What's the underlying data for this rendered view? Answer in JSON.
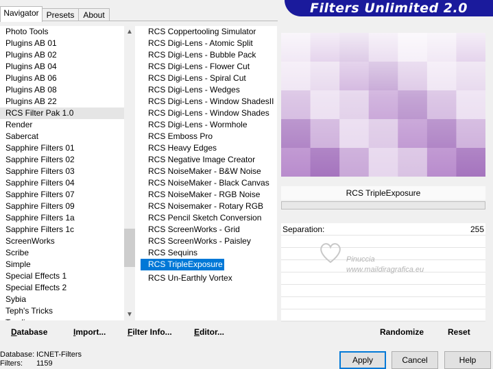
{
  "tabs": [
    "Navigator",
    "Presets",
    "About"
  ],
  "brand": "Filters Unlimited 2.0",
  "categories": [
    "Photo Tools",
    "Plugins AB 01",
    "Plugins AB 02",
    "Plugins AB 04",
    "Plugins AB 06",
    "Plugins AB 08",
    "Plugins AB 22",
    "RCS Filter Pak 1.0",
    "Render",
    "Sabercat",
    "Sapphire Filters 01",
    "Sapphire Filters 02",
    "Sapphire Filters 03",
    "Sapphire Filters 04",
    "Sapphire Filters 07",
    "Sapphire Filters 09",
    "Sapphire Filters 1a",
    "Sapphire Filters 1c",
    "ScreenWorks",
    "Scribe",
    "Simple",
    "Special Effects 1",
    "Special Effects 2",
    "Sybia",
    "Teph's Tricks",
    "Toadies"
  ],
  "selected_category": "RCS Filter Pak 1.0",
  "filters": [
    "RCS Coppertooling Simulator",
    "RCS Digi-Lens - Atomic Split",
    "RCS Digi-Lens - Bubble Pack",
    "RCS Digi-Lens - Flower Cut",
    "RCS Digi-Lens - Spiral Cut",
    "RCS Digi-Lens - Wedges",
    "RCS Digi-Lens - Window ShadesII",
    "RCS Digi-Lens - Window Shades",
    "RCS Digi-Lens - Wormhole",
    "RCS Emboss Pro",
    "RCS Heavy Edges",
    "RCS Negative Image Creator",
    "RCS NoiseMaker - B&W Noise",
    "RCS NoiseMaker - Black Canvas",
    "RCS NoiseMaker - RGB Noise",
    "RCS Noisemaker - Rotary RGB",
    "RCS Pencil Sketch Conversion",
    "RCS ScreenWorks - Grid",
    "RCS ScreenWorks - Paisley",
    "RCS Sequins",
    "RCS TripleExposure",
    "RCS Un-Earthly Vortex"
  ],
  "selected_filter": "RCS TripleExposure",
  "filter_name": "RCS TripleExposure",
  "param": {
    "label": "Separation:",
    "value": "255"
  },
  "watermark": {
    "line1": "Pinuccia",
    "line2": "www.maildiragrafica.eu"
  },
  "buttons_left": [
    "Database",
    "Import...",
    "Filter Info...",
    "Editor..."
  ],
  "buttons_right": [
    "Randomize",
    "Reset"
  ],
  "status": {
    "db_label": "Database:",
    "db_value": "ICNET-Filters",
    "filters_label": "Filters:",
    "filters_value": "1159"
  },
  "dialog_buttons": [
    "Apply",
    "Cancel",
    "Help"
  ],
  "colors": {
    "accent": "#0078d7",
    "banner": "#1a1a9c",
    "preview_purple": "#b98ccd"
  }
}
